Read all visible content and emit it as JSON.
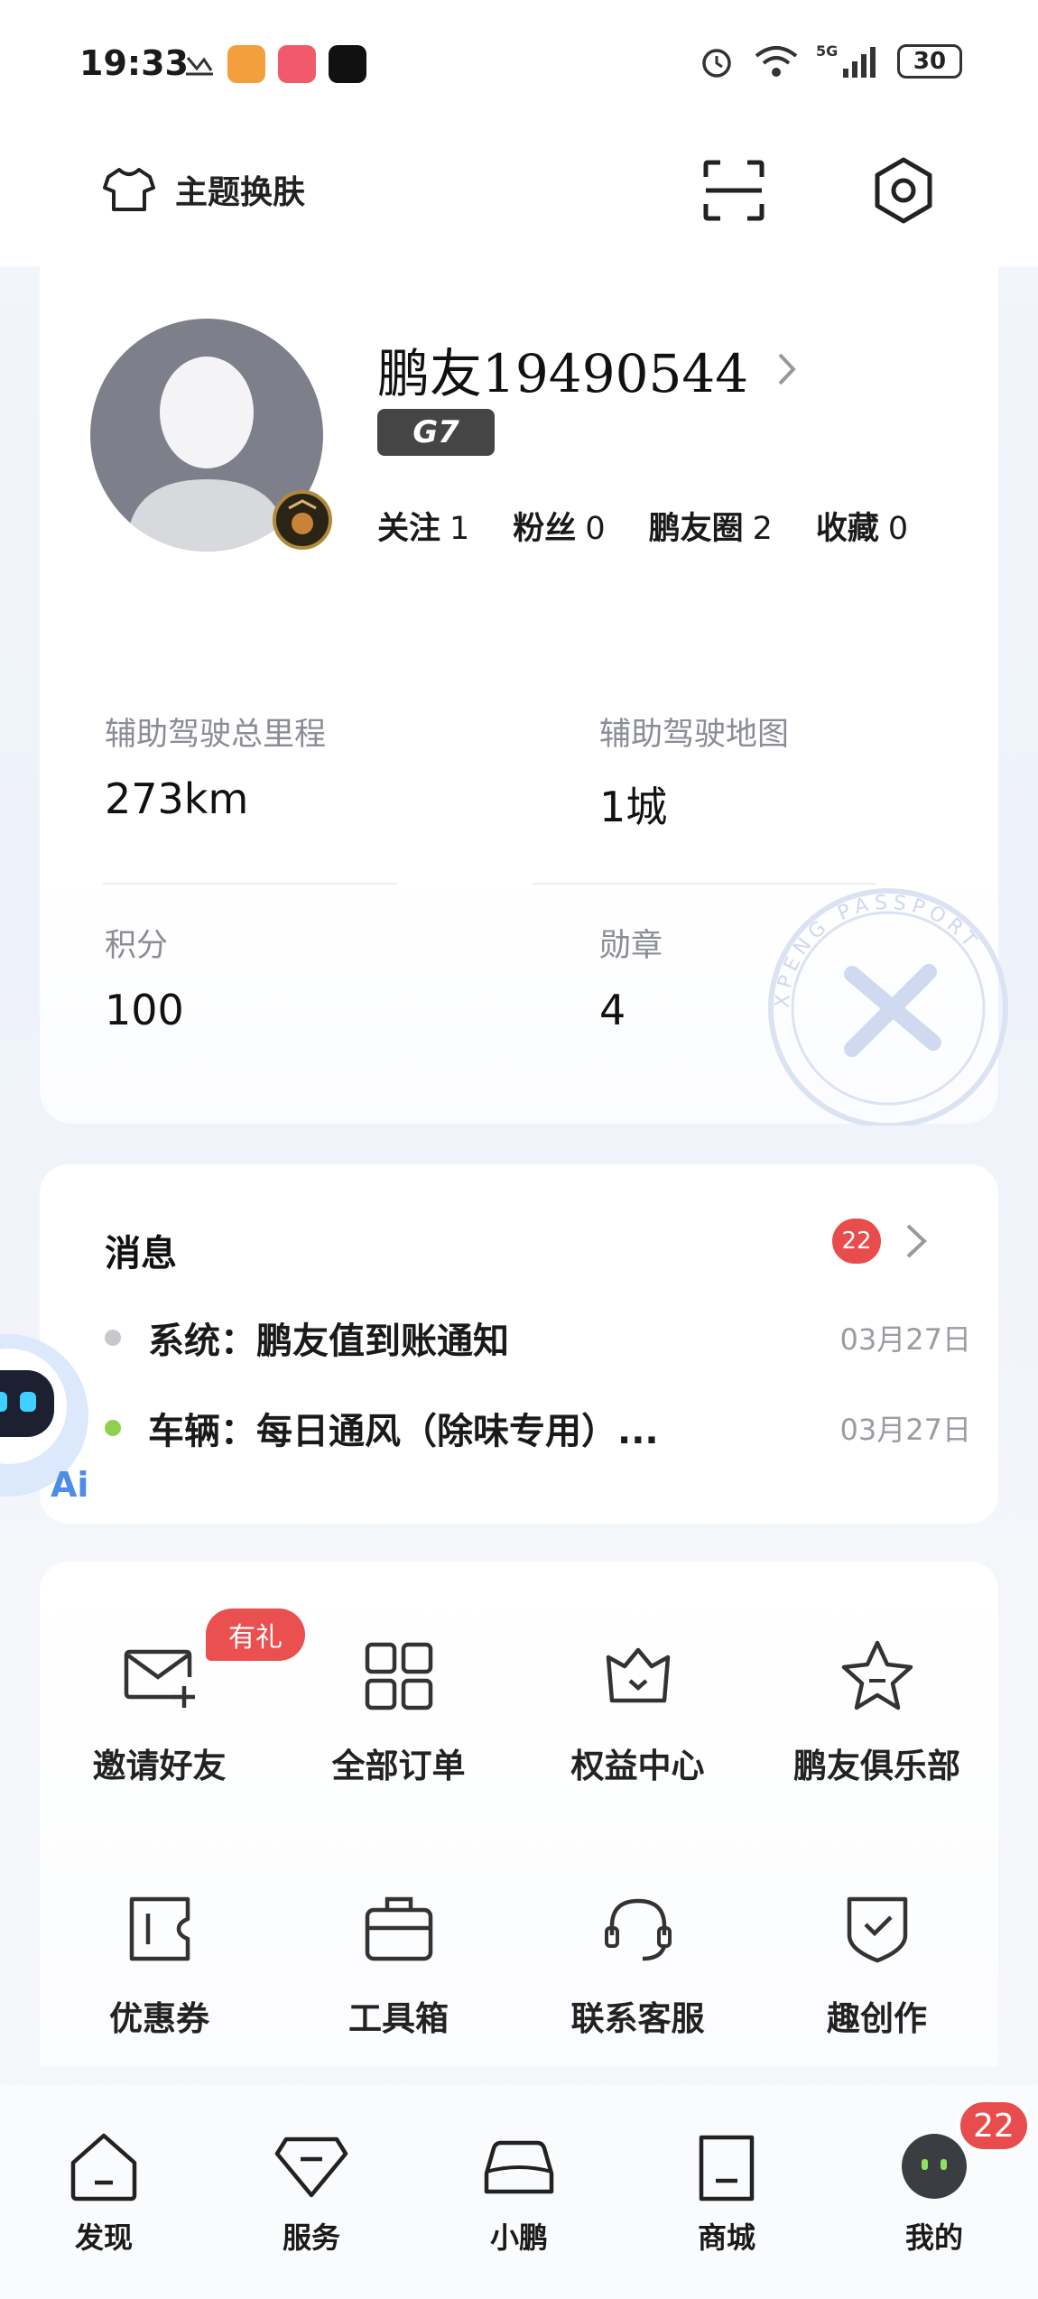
{
  "status_bar": {
    "time": "19:33",
    "battery": "30",
    "network": "5G"
  },
  "header": {
    "theme_label": "主题换肤",
    "icons": [
      "tshirt-icon",
      "scan-icon",
      "settings-icon"
    ]
  },
  "profile": {
    "username": "鹏友19490544",
    "car_model": "G7",
    "stats": [
      {
        "label": "关注",
        "value": "1"
      },
      {
        "label": "粉丝",
        "value": "0"
      },
      {
        "label": "鹏友圈",
        "value": "2"
      },
      {
        "label": "收藏",
        "value": "0"
      }
    ],
    "metrics": [
      {
        "label": "辅助驾驶总里程",
        "value": "273km"
      },
      {
        "label": "辅助驾驶地图",
        "value": "1城"
      },
      {
        "label": "积分",
        "value": "100"
      },
      {
        "label": "勋章",
        "value": "4"
      }
    ],
    "passport_text": "XPENG PASSPORT"
  },
  "messages": {
    "title": "消息",
    "count": "22",
    "items": [
      {
        "text": "系统：鹏友值到账通知",
        "date": "03月27日",
        "dot_color": "#c8c8cc"
      },
      {
        "text": "车辆：每日通风（除味专用）...",
        "date": "03月27日",
        "dot_color": "#8fd14f"
      }
    ]
  },
  "ai_bot": {
    "label": "Ai"
  },
  "shortcuts": [
    {
      "label": "邀请好友",
      "icon": "invite-mail-icon",
      "badge": "有礼"
    },
    {
      "label": "全部订单",
      "icon": "grid-icon"
    },
    {
      "label": "权益中心",
      "icon": "crown-icon"
    },
    {
      "label": "鹏友俱乐部",
      "icon": "star-icon"
    },
    {
      "label": "优惠券",
      "icon": "coupon-icon"
    },
    {
      "label": "工具箱",
      "icon": "toolbox-icon"
    },
    {
      "label": "联系客服",
      "icon": "headset-icon"
    },
    {
      "label": "趣创作",
      "icon": "shield-check-icon"
    }
  ],
  "tabbar": {
    "items": [
      {
        "label": "发现",
        "icon": "discover-icon"
      },
      {
        "label": "服务",
        "icon": "service-icon"
      },
      {
        "label": "小鹏",
        "icon": "car-icon"
      },
      {
        "label": "商城",
        "icon": "mall-icon"
      },
      {
        "label": "我的",
        "icon": "profile-icon"
      }
    ],
    "badge": "22",
    "active": "我的"
  }
}
